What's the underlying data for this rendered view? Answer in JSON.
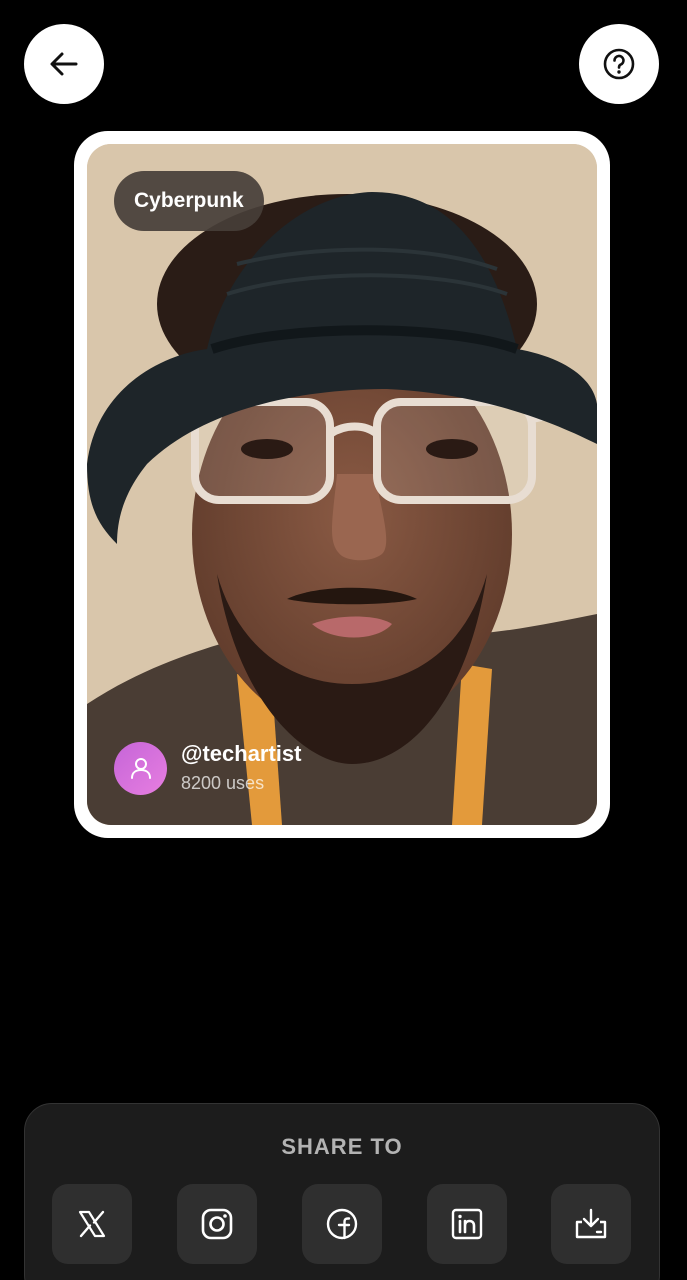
{
  "header": {
    "back_icon": "arrow-left-icon",
    "help_icon": "question-circle-icon"
  },
  "card": {
    "style_label": "Cyberpunk",
    "author": {
      "handle": "@techartist",
      "uses": "8200 uses",
      "avatar_icon": "user-icon"
    }
  },
  "share": {
    "title": "SHARE TO",
    "buttons": [
      {
        "id": "x",
        "icon": "x-logo-icon"
      },
      {
        "id": "instagram",
        "icon": "instagram-icon"
      },
      {
        "id": "facebook",
        "icon": "facebook-icon"
      },
      {
        "id": "linkedin",
        "icon": "linkedin-icon"
      },
      {
        "id": "download",
        "icon": "download-icon"
      }
    ]
  },
  "colors": {
    "background": "#000000",
    "panel": "#1c1c1c",
    "share_button": "#2f2f2f",
    "avatar": "#d46fdd",
    "pill": "#463e38"
  }
}
